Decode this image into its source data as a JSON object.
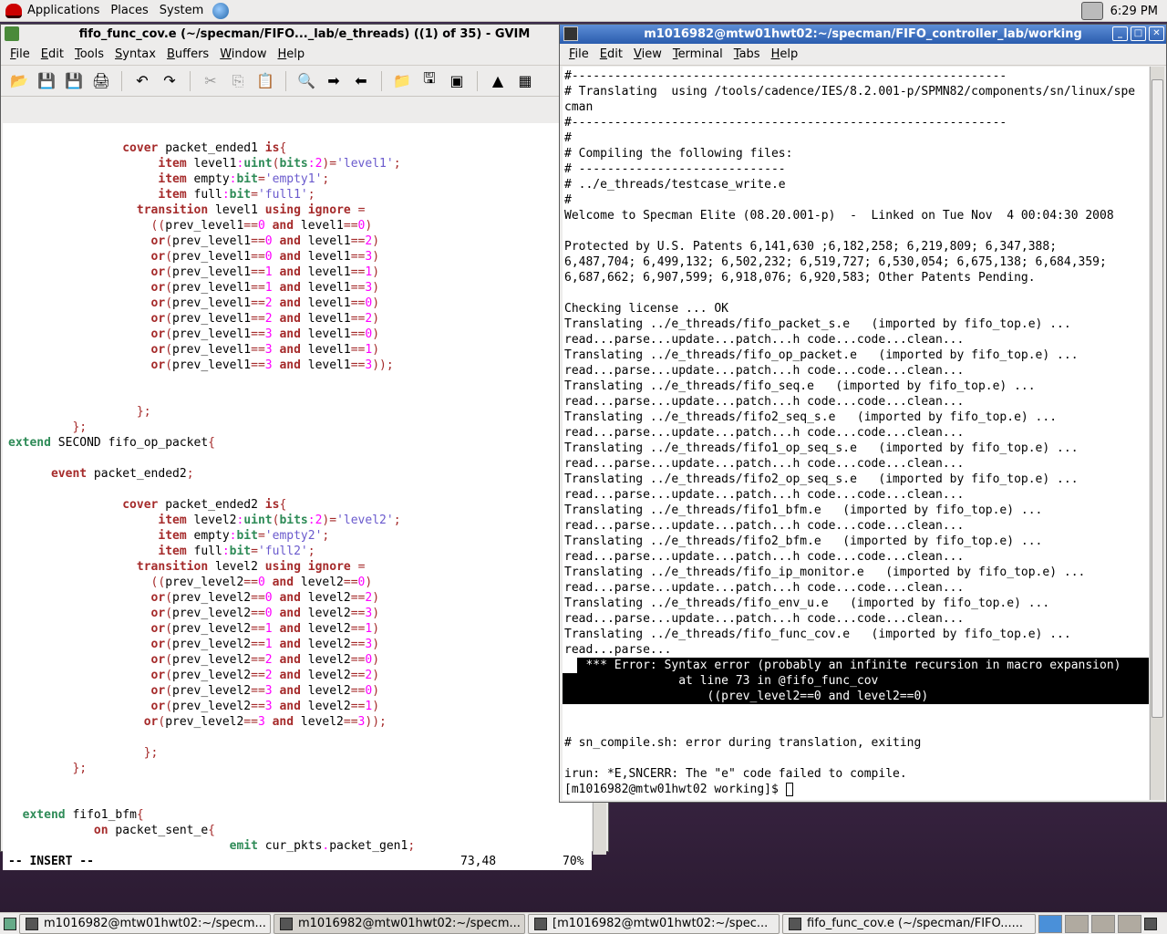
{
  "top_panel": {
    "menus": [
      "Applications",
      "Places",
      "System"
    ],
    "clock": "6:29 PM"
  },
  "gvim": {
    "title": "fifo_func_cov.e (~/specman/FIFO..._lab/e_threads) ((1) of 35) - GVIM",
    "menu": [
      "File",
      "Edit",
      "Tools",
      "Syntax",
      "Buffers",
      "Window",
      "Help"
    ],
    "toolbar": [
      "open-icon",
      "save-icon",
      "save-all-icon",
      "print-icon",
      "undo-icon",
      "redo-icon",
      "cut-icon",
      "copy-icon",
      "paste-icon",
      "find-replace-icon",
      "find-next-icon",
      "find-prev-icon",
      "load-session-icon",
      "save-session-icon",
      "run-script-icon",
      "make-icon",
      "tag-icon"
    ],
    "lines": [
      "                cover packet_ended1 is{",
      "                     item level1:uint(bits:2)='level1';",
      "                     item empty:bit='empty1';",
      "                     item full:bit='full1';",
      "                  transition level1 using ignore =",
      "                    ((prev_level1==0 and level1==0)",
      "                    or(prev_level1==0 and level1==2)",
      "                    or(prev_level1==0 and level1==3)",
      "                    or(prev_level1==1 and level1==1)",
      "                    or(prev_level1==1 and level1==3)",
      "                    or(prev_level1==2 and level1==0)",
      "                    or(prev_level1==2 and level1==2)",
      "                    or(prev_level1==3 and level1==0)",
      "                    or(prev_level1==3 and level1==1)",
      "                    or(prev_level1==3 and level1==3));",
      "",
      "",
      "                  };",
      "         };",
      "extend SECOND fifo_op_packet{",
      "",
      "      event packet_ended2;",
      "",
      "                cover packet_ended2 is{",
      "                     item level2:uint(bits:2)='level2';",
      "                     item empty:bit='empty2';",
      "                     item full:bit='full2';",
      "                  transition level2 using ignore =",
      "                    ((prev_level2==0 and level2==0)",
      "                    or(prev_level2==0 and level2==2)",
      "                    or(prev_level2==0 and level2==3)",
      "                    or(prev_level2==1 and level2==1)",
      "                    or(prev_level2==1 and level2==3)",
      "                    or(prev_level2==2 and level2==0)",
      "                    or(prev_level2==2 and level2==2)",
      "                    or(prev_level2==3 and level2==0)",
      "                    or(prev_level2==3 and level2==1)",
      "                   or(prev_level2==3 and level2==3));",
      "",
      "                   };",
      "         };",
      "",
      "",
      "  extend fifo1_bfm{",
      "            on packet_sent_e{",
      "                               emit cur_pkts.packet_gen1;"
    ],
    "status": {
      "mode": "-- INSERT --",
      "position": "73,48",
      "percent": "70%"
    }
  },
  "terminal": {
    "title": "m1016982@mtw01hwt02:~/specman/FIFO_controller_lab/working",
    "menu": [
      "File",
      "Edit",
      "View",
      "Terminal",
      "Tabs",
      "Help"
    ],
    "lines": [
      "#-------------------------------------------------------------",
      "# Translating  using /tools/cadence/IES/8.2.001-p/SPMN82/components/sn/linux/spe",
      "cman",
      "#-------------------------------------------------------------",
      "#",
      "# Compiling the following files:",
      "# -----------------------------",
      "# ../e_threads/testcase_write.e",
      "#",
      "Welcome to Specman Elite (08.20.001-p)  -  Linked on Tue Nov  4 00:04:30 2008",
      "",
      "Protected by U.S. Patents 6,141,630 ;6,182,258; 6,219,809; 6,347,388;",
      "6,487,704; 6,499,132; 6,502,232; 6,519,727; 6,530,054; 6,675,138; 6,684,359;",
      "6,687,662; 6,907,599; 6,918,076; 6,920,583; Other Patents Pending.",
      "",
      "Checking license ... OK",
      "Translating ../e_threads/fifo_packet_s.e   (imported by fifo_top.e) ...",
      "read...parse...update...patch...h code...code...clean...",
      "Translating ../e_threads/fifo_op_packet.e   (imported by fifo_top.e) ...",
      "read...parse...update...patch...h code...code...clean...",
      "Translating ../e_threads/fifo_seq.e   (imported by fifo_top.e) ...",
      "read...parse...update...patch...h code...code...clean...",
      "Translating ../e_threads/fifo2_seq_s.e   (imported by fifo_top.e) ...",
      "read...parse...update...patch...h code...code...clean...",
      "Translating ../e_threads/fifo1_op_seq_s.e   (imported by fifo_top.e) ...",
      "read...parse...update...patch...h code...code...clean...",
      "Translating ../e_threads/fifo2_op_seq_s.e   (imported by fifo_top.e) ...",
      "read...parse...update...patch...h code...code...clean...",
      "Translating ../e_threads/fifo1_bfm.e   (imported by fifo_top.e) ...",
      "read...parse...update...patch...h code...code...clean...",
      "Translating ../e_threads/fifo2_bfm.e   (imported by fifo_top.e) ...",
      "read...parse...update...patch...h code...code...clean...",
      "Translating ../e_threads/fifo_ip_monitor.e   (imported by fifo_top.e) ...",
      "read...parse...update...patch...h code...code...clean...",
      "Translating ../e_threads/fifo_env_u.e   (imported by fifo_top.e) ...",
      "read...parse...update...patch...h code...code...clean...",
      "Translating ../e_threads/fifo_func_cov.e   (imported by fifo_top.e) ...",
      "read...parse..."
    ],
    "error_lines": [
      "   *** Error: Syntax error (probably an infinite recursion in macro expansion)",
      "                at line 73 in @fifo_func_cov",
      "                    ((prev_level2==0 and level2==0)"
    ],
    "tail_lines": [
      "",
      "",
      "# sn_compile.sh: error during translation, exiting",
      "",
      "irun: *E,SNCERR: The \"e\" code failed to compile."
    ],
    "prompt": "[m1016982@mtw01hwt02 working]$ "
  },
  "taskbar": {
    "tasks": [
      {
        "label": "m1016982@mtw01hwt02:~/specm...",
        "active": false
      },
      {
        "label": "m1016982@mtw01hwt02:~/specm...",
        "active": true
      },
      {
        "label": "[m1016982@mtw01hwt02:~/spec...",
        "active": false
      },
      {
        "label": "fifo_func_cov.e (~/specman/FIFO......",
        "active": false
      }
    ]
  }
}
